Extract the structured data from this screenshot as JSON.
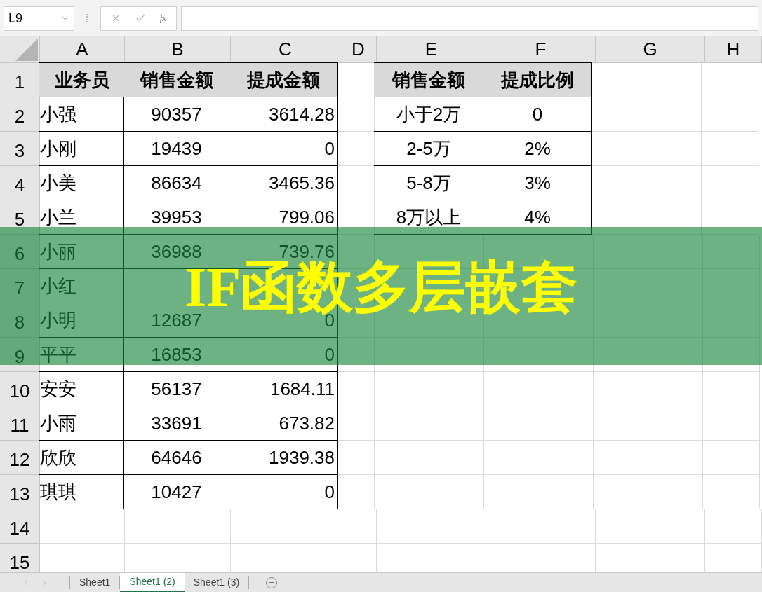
{
  "name_box": {
    "value": "L9"
  },
  "formula_bar": {
    "function_label": "fx"
  },
  "columns": [
    {
      "label": "A"
    },
    {
      "label": "B"
    },
    {
      "label": "C"
    },
    {
      "label": "D"
    },
    {
      "label": "E"
    },
    {
      "label": "F"
    },
    {
      "label": "G"
    },
    {
      "label": "H"
    }
  ],
  "rows": [
    {
      "header": "1",
      "kind": "header",
      "cells": [
        {
          "text": "业务员"
        },
        {
          "text": "销售金额"
        },
        {
          "text": "提成金额"
        },
        null,
        {
          "text": "销售金额"
        },
        {
          "text": "提成比例"
        },
        null,
        null
      ]
    },
    {
      "header": "2",
      "kind": "data",
      "cells": [
        {
          "text": "小强"
        },
        {
          "text": "90357"
        },
        {
          "text": "3614.28"
        },
        null,
        {
          "text": "小于2万"
        },
        {
          "text": "0"
        },
        null,
        null
      ]
    },
    {
      "header": "3",
      "kind": "data",
      "cells": [
        {
          "text": "小刚"
        },
        {
          "text": "19439"
        },
        {
          "text": "0"
        },
        null,
        {
          "text": "2-5万"
        },
        {
          "text": "2%"
        },
        null,
        null
      ]
    },
    {
      "header": "4",
      "kind": "data",
      "cells": [
        {
          "text": "小美"
        },
        {
          "text": "86634"
        },
        {
          "text": "3465.36"
        },
        null,
        {
          "text": "5-8万"
        },
        {
          "text": "3%"
        },
        null,
        null
      ]
    },
    {
      "header": "5",
      "kind": "data",
      "cells": [
        {
          "text": "小兰"
        },
        {
          "text": "39953"
        },
        {
          "text": "799.06"
        },
        null,
        {
          "text": "8万以上"
        },
        {
          "text": "4%"
        },
        null,
        null
      ]
    },
    {
      "header": "6",
      "kind": "data",
      "cells": [
        {
          "text": "小丽"
        },
        {
          "text": "36988"
        },
        {
          "text": "739.76"
        },
        null,
        null,
        null,
        null,
        null
      ]
    },
    {
      "header": "7",
      "kind": "data",
      "cells": [
        {
          "text": "小红"
        },
        {},
        {},
        null,
        null,
        null,
        null,
        null
      ]
    },
    {
      "header": "8",
      "kind": "data",
      "cells": [
        {
          "text": "小明"
        },
        {
          "text": "12687"
        },
        {
          "text": "0"
        },
        null,
        null,
        null,
        null,
        null
      ]
    },
    {
      "header": "9",
      "kind": "data",
      "cells": [
        {
          "text": "平平"
        },
        {
          "text": "16853"
        },
        {
          "text": "0"
        },
        null,
        null,
        null,
        null,
        null
      ]
    },
    {
      "header": "10",
      "kind": "data",
      "cells": [
        {
          "text": "安安"
        },
        {
          "text": "56137"
        },
        {
          "text": "1684.11"
        },
        null,
        null,
        null,
        null,
        null
      ]
    },
    {
      "header": "11",
      "kind": "data",
      "cells": [
        {
          "text": "小雨"
        },
        {
          "text": "33691"
        },
        {
          "text": "673.82"
        },
        null,
        null,
        null,
        null,
        null
      ]
    },
    {
      "header": "12",
      "kind": "data",
      "cells": [
        {
          "text": "欣欣"
        },
        {
          "text": "64646"
        },
        {
          "text": "1939.38"
        },
        null,
        null,
        null,
        null,
        null
      ]
    },
    {
      "header": "13",
      "kind": "data",
      "cells": [
        {
          "text": "琪琪"
        },
        {
          "text": "10427"
        },
        {
          "text": "0"
        },
        null,
        null,
        null,
        null,
        null
      ]
    },
    {
      "header": "14",
      "kind": "data",
      "cells": [
        null,
        null,
        null,
        null,
        null,
        null,
        null,
        null
      ]
    },
    {
      "header": "15",
      "kind": "data",
      "cells": [
        null,
        null,
        null,
        null,
        null,
        null,
        null,
        null
      ]
    }
  ],
  "banner": {
    "title": "IF函数多层嵌套"
  },
  "sheet_tabs": [
    {
      "label": "Sheet1",
      "selected": false
    },
    {
      "label": "Sheet1 (2)",
      "selected": true
    },
    {
      "label": "Sheet1 (3)",
      "selected": false
    }
  ]
}
